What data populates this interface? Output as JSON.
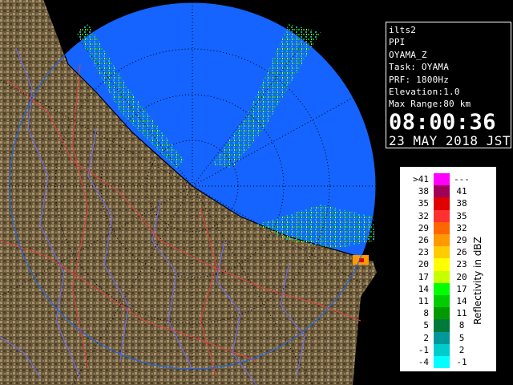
{
  "info": {
    "lines": [
      "ilts2",
      "PPI",
      "OYAMA_Z",
      "Task: OYAMA",
      "PRF: 1800Hz",
      "Elevation:1.0",
      "Max Range:80 km"
    ],
    "time": "08:00:36",
    "date": "23 MAY 2018 JST"
  },
  "legend": {
    "title": "Reflectivity in dBZ",
    "rows": [
      {
        "low": ">41",
        "high": "---",
        "color": "#ff00ff"
      },
      {
        "low": "38",
        "high": "41",
        "color": "#a0005a"
      },
      {
        "low": "35",
        "high": "38",
        "color": "#e00000"
      },
      {
        "low": "32",
        "high": "35",
        "color": "#ff3030"
      },
      {
        "low": "29",
        "high": "32",
        "color": "#ff6600"
      },
      {
        "low": "26",
        "high": "29",
        "color": "#ff9900"
      },
      {
        "low": "23",
        "high": "26",
        "color": "#ffcc00"
      },
      {
        "low": "20",
        "high": "23",
        "color": "#ffff00"
      },
      {
        "low": "17",
        "high": "20",
        "color": "#c8ff00"
      },
      {
        "low": "14",
        "high": "17",
        "color": "#00ff00"
      },
      {
        "low": "11",
        "high": "14",
        "color": "#00cc00"
      },
      {
        "low": "8",
        "high": "11",
        "color": "#009a00"
      },
      {
        "low": "5",
        "high": "8",
        "color": "#007a3a"
      },
      {
        "low": "2",
        "high": "5",
        "color": "#009999"
      },
      {
        "low": "-1",
        "high": "2",
        "color": "#00cccc"
      },
      {
        "low": "-4",
        "high": "-1",
        "color": "#00ffff"
      }
    ]
  },
  "colors": {
    "radar_background": "#1564ff",
    "land": "#6b5a3c",
    "sea": "#1e4fff",
    "river": "#6a6aff",
    "road": "#e04040",
    "range_ring": "#000000"
  }
}
